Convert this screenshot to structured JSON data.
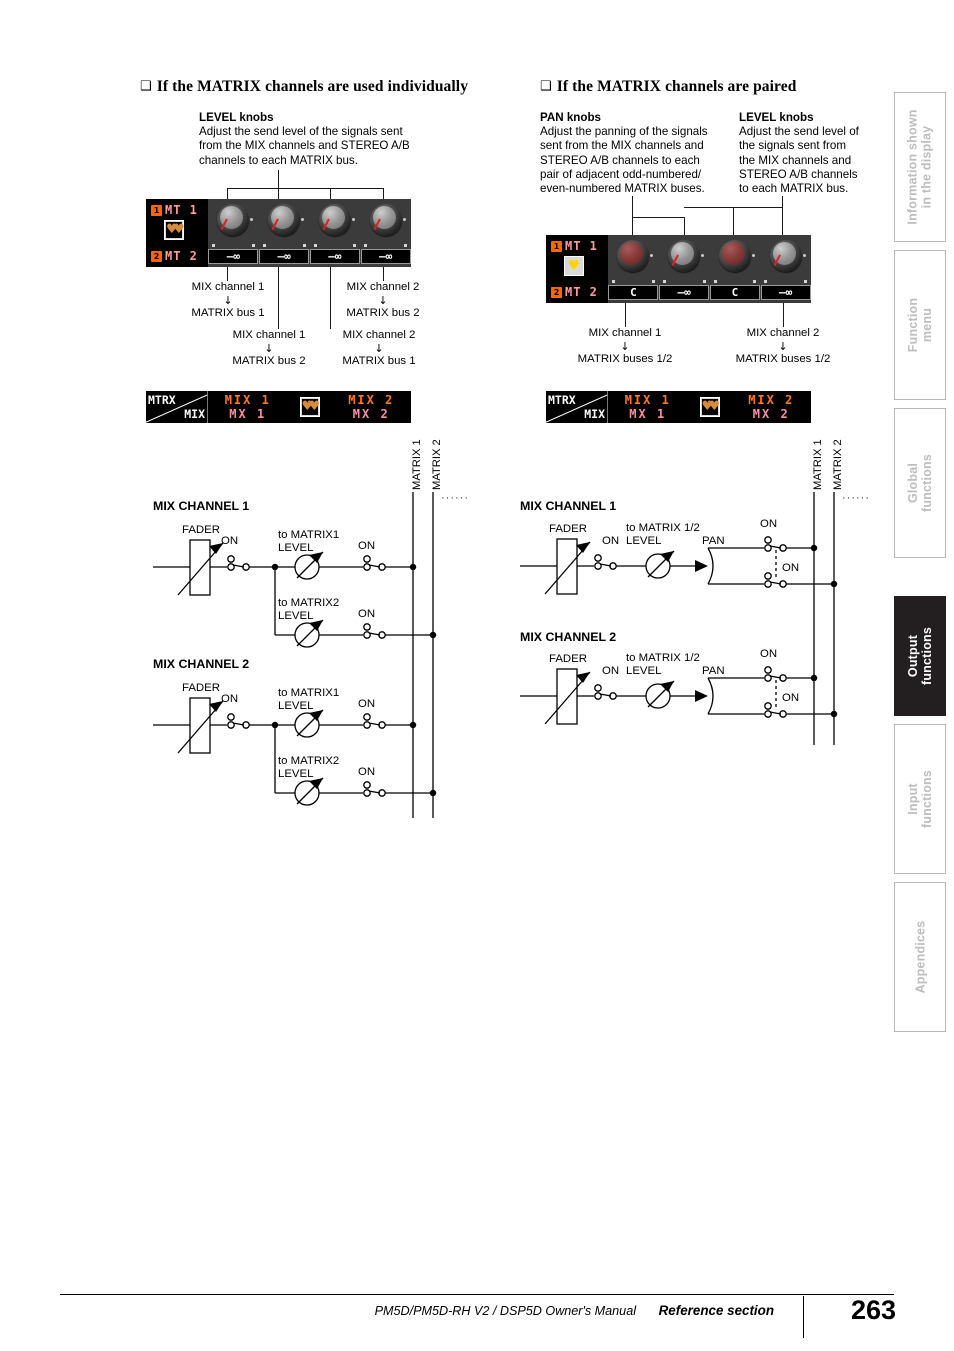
{
  "left_section": {
    "heading": "If the MATRIX channels are used individually",
    "callout": {
      "title": "LEVEL knobs",
      "body": "Adjust the send level of the signals sent\nfrom the MIX channels and STEREO A/B\nchannels to each MATRIX bus."
    },
    "lcd": {
      "row1_label": "MT 1",
      "row1_badge": "1",
      "row2_label": "MT 2",
      "row2_badge": "2",
      "pair_icon": "broken-heart-icon",
      "knobs": [
        {
          "type": "level",
          "value": "–∞"
        },
        {
          "type": "level",
          "value": "–∞"
        },
        {
          "type": "level",
          "value": "–∞"
        },
        {
          "type": "level",
          "value": "–∞"
        }
      ]
    },
    "routing_labels": [
      {
        "from": "MIX channel 1",
        "arrow": "↓",
        "to": "MATRIX bus 1"
      },
      {
        "from": "MIX channel 2",
        "arrow": "↓",
        "to": "MATRIX bus 2"
      },
      {
        "from": "MIX channel 1",
        "arrow": "↓",
        "to": "MATRIX bus 2"
      },
      {
        "from": "MIX channel 2",
        "arrow": "↓",
        "to": "MATRIX bus 1"
      }
    ],
    "mtrx_bar": {
      "corner_top": "MTRX",
      "corner_bottom": "MIX",
      "cell1_top": "MIX 1",
      "cell1_bottom": "MX 1",
      "cell2_top": "MIX 2",
      "cell2_bottom": "MX 2",
      "pair_icon": "broken-heart-icon"
    },
    "flow": {
      "bus_label_1": "MATRIX 1",
      "bus_label_2": "MATRIX 2",
      "ellipsis": "······",
      "channels": [
        {
          "title": "MIX CHANNEL 1",
          "fader": "FADER",
          "fader_on": "ON",
          "sends": [
            {
              "label_line1": "to MATRIX1",
              "label_line2": "LEVEL",
              "on": "ON"
            },
            {
              "label_line1": "to MATRIX2",
              "label_line2": "LEVEL",
              "on": "ON"
            }
          ]
        },
        {
          "title": "MIX CHANNEL 2",
          "fader": "FADER",
          "fader_on": "ON",
          "sends": [
            {
              "label_line1": "to MATRIX1",
              "label_line2": "LEVEL",
              "on": "ON"
            },
            {
              "label_line1": "to MATRIX2",
              "label_line2": "LEVEL",
              "on": "ON"
            }
          ]
        }
      ]
    }
  },
  "right_section": {
    "heading": "If the MATRIX channels are paired",
    "callout_pan": {
      "title": "PAN knobs",
      "body": "Adjust the panning of the signals\nsent from the MIX channels and\nSTEREO A/B channels to each\npair of adjacent odd-numbered/\neven-numbered MATRIX buses."
    },
    "callout_level": {
      "title": "LEVEL knobs",
      "body": "Adjust the send level of\nthe signals sent from\nthe MIX channels and\nSTEREO A/B channels\nto each MATRIX bus."
    },
    "lcd": {
      "row1_label": "MT 1",
      "row1_badge": "1",
      "row2_label": "MT 2",
      "row2_badge": "2",
      "pair_icon": "whole-heart-icon",
      "knobs": [
        {
          "type": "pan",
          "value": "C"
        },
        {
          "type": "level",
          "value": "–∞"
        },
        {
          "type": "pan",
          "value": "C"
        },
        {
          "type": "level",
          "value": "–∞"
        }
      ]
    },
    "routing_labels": [
      {
        "from": "MIX channel 1",
        "arrow": "↓",
        "to": "MATRIX buses 1/2"
      },
      {
        "from": "MIX channel 2",
        "arrow": "↓",
        "to": "MATRIX buses 1/2"
      }
    ],
    "mtrx_bar": {
      "corner_top": "MTRX",
      "corner_bottom": "MIX",
      "cell1_top": "MIX 1",
      "cell1_bottom": "MX 1",
      "cell2_top": "MIX 2",
      "cell2_bottom": "MX 2",
      "pair_icon": "whole-heart-icon"
    },
    "flow": {
      "bus_label_1": "MATRIX 1",
      "bus_label_2": "MATRIX 2",
      "ellipsis": "······",
      "channels": [
        {
          "title": "MIX CHANNEL 1",
          "fader": "FADER",
          "fader_on": "ON",
          "send_label_line1": "to MATRIX 1/2",
          "send_label_line2": "LEVEL",
          "pan": "PAN",
          "on_top": "ON",
          "on_bottom": "ON"
        },
        {
          "title": "MIX CHANNEL 2",
          "fader": "FADER",
          "fader_on": "ON",
          "send_label_line1": "to MATRIX 1/2",
          "send_label_line2": "LEVEL",
          "pan": "PAN",
          "on_top": "ON",
          "on_bottom": "ON"
        }
      ]
    }
  },
  "rail": {
    "tabs": [
      {
        "line1": "Information shown",
        "line2": "in the display",
        "active": false
      },
      {
        "line1": "Function",
        "line2": "menu",
        "active": false
      },
      {
        "line1": "Global",
        "line2": "functions",
        "active": false
      },
      {
        "line1": "Output",
        "line2": "functions",
        "active": true
      },
      {
        "line1": "Input",
        "line2": "functions",
        "active": false
      },
      {
        "line1": "Appendices",
        "line2": "",
        "active": false
      }
    ]
  },
  "footer": {
    "manual": "PM5D/PM5D-RH V2 / DSP5D Owner's Manual",
    "section": "Reference section",
    "page": "263"
  }
}
